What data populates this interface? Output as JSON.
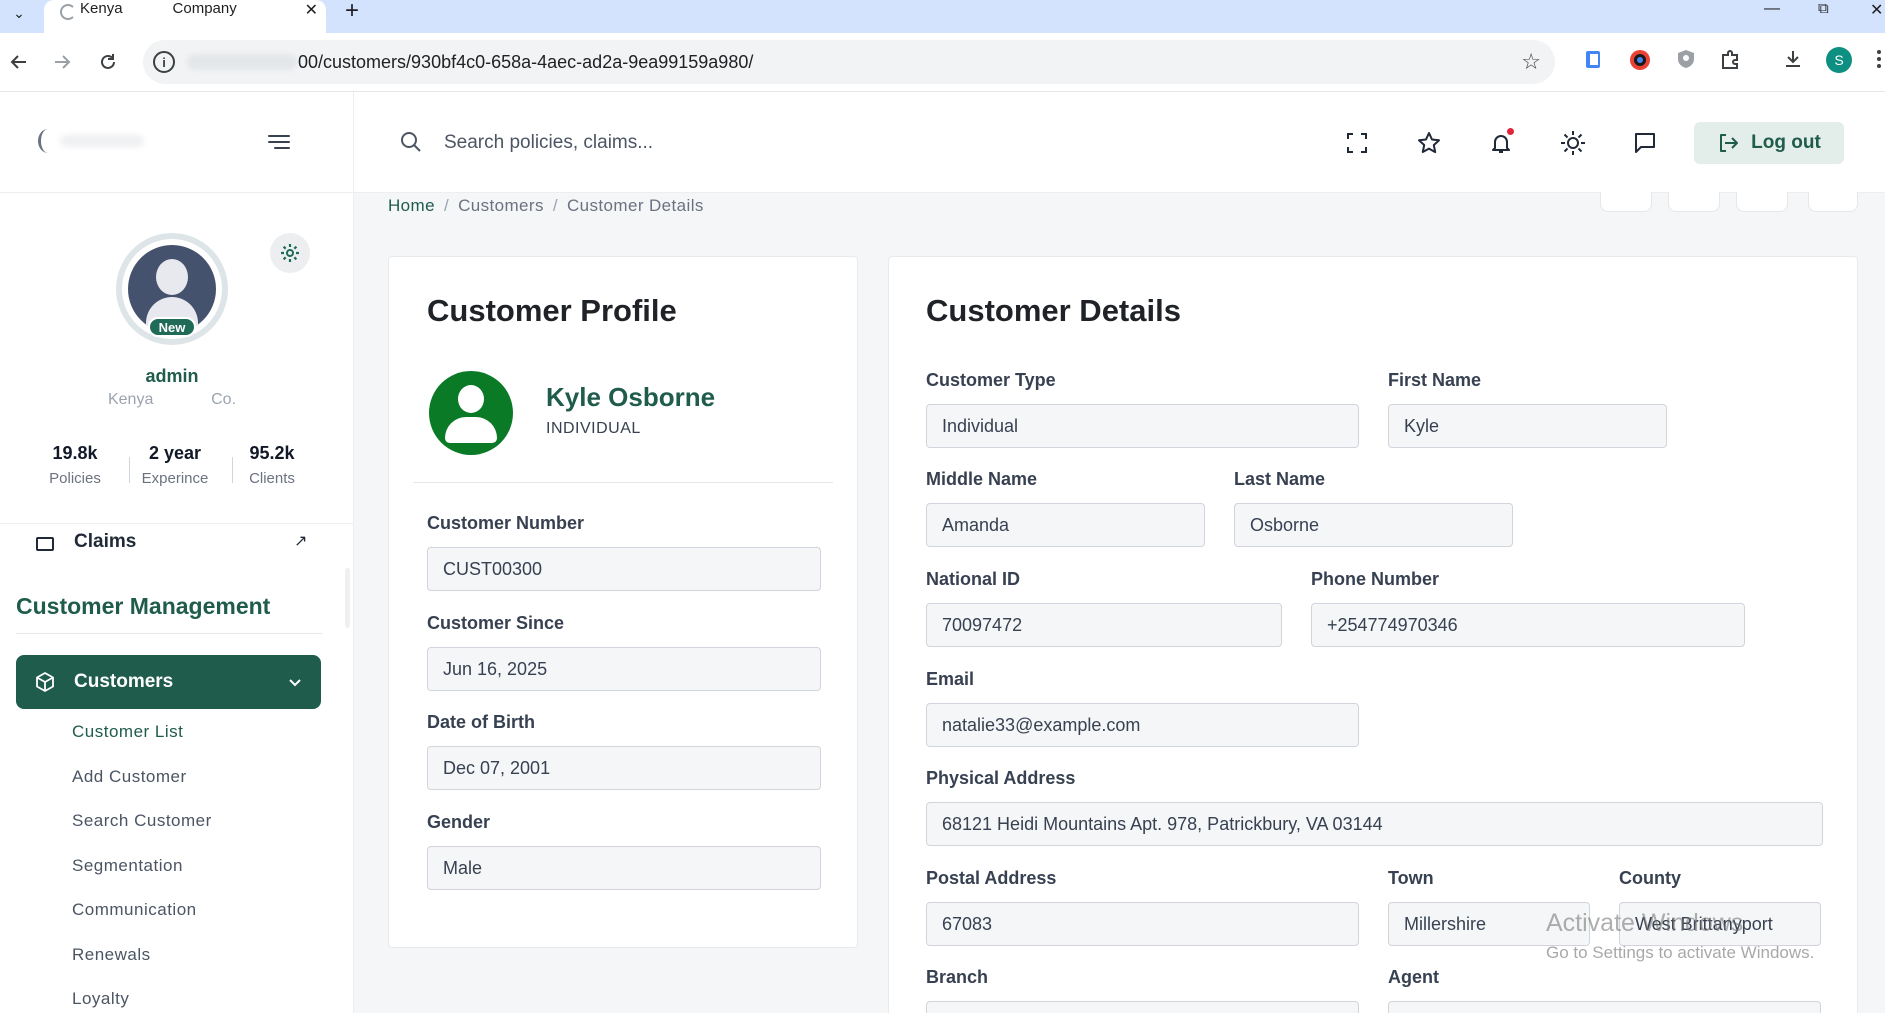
{
  "browser": {
    "tab_title": "Kenya            Company",
    "address_url": "00/customers/930bf4c0-658a-4aec-ad2a-9ea99159a980/",
    "profile_initial": "S"
  },
  "header": {
    "search_placeholder": "Search policies, claims...",
    "logout_label": "Log out"
  },
  "profile_panel": {
    "badge": "New",
    "user_name": "admin",
    "company": "Kenya             Co.",
    "stats": [
      {
        "value": "19.8k",
        "label": "Policies"
      },
      {
        "value": "2 year",
        "label": "Experince"
      },
      {
        "value": "95.2k",
        "label": "Clients"
      }
    ]
  },
  "sidebar": {
    "claims_label": "Claims",
    "section_title": "Customer Management",
    "active_item": "Customers",
    "submenu": [
      "Customer List",
      "Add Customer",
      "Search Customer",
      "Segmentation",
      "Communication",
      "Renewals",
      "Loyalty"
    ]
  },
  "breadcrumb": {
    "home": "Home",
    "section": "Customers",
    "current": "Customer Details",
    "separator": "/"
  },
  "profile_card": {
    "title": "Customer Profile",
    "name": "Kyle Osborne",
    "type": "INDIVIDUAL",
    "fields": {
      "customer_number": {
        "label": "Customer Number",
        "value": "CUST00300"
      },
      "customer_since": {
        "label": "Customer Since",
        "value": "Jun 16, 2025"
      },
      "date_of_birth": {
        "label": "Date of Birth",
        "value": "Dec 07, 2001"
      },
      "gender": {
        "label": "Gender",
        "value": "Male"
      }
    }
  },
  "details_card": {
    "title": "Customer Details",
    "fields": {
      "customer_type": {
        "label": "Customer Type",
        "value": "Individual"
      },
      "first_name": {
        "label": "First Name",
        "value": "Kyle"
      },
      "middle_name": {
        "label": "Middle Name",
        "value": "Amanda"
      },
      "last_name": {
        "label": "Last Name",
        "value": "Osborne"
      },
      "national_id": {
        "label": "National ID",
        "value": "70097472"
      },
      "phone_number": {
        "label": "Phone Number",
        "value": "+254774970346"
      },
      "email": {
        "label": "Email",
        "value": "natalie33@example.com"
      },
      "physical_address": {
        "label": "Physical Address",
        "value": "68121 Heidi Mountains Apt. 978, Patrickbury, VA 03144"
      },
      "postal_address": {
        "label": "Postal Address",
        "value": "67083"
      },
      "town": {
        "label": "Town",
        "value": "Millershire"
      },
      "county": {
        "label": "County",
        "value": "West Brittanyport"
      },
      "branch": {
        "label": "Branch"
      },
      "agent": {
        "label": "Agent"
      }
    }
  },
  "os_watermark": {
    "line1": "Activate Windows",
    "line2": "Go to Settings to activate Windows."
  },
  "colors": {
    "brand_green": "#1f5c4b",
    "avatar_green": "#0b7a26",
    "tab_strip": "#d3e3fd",
    "notification_dot": "#e0263a"
  }
}
